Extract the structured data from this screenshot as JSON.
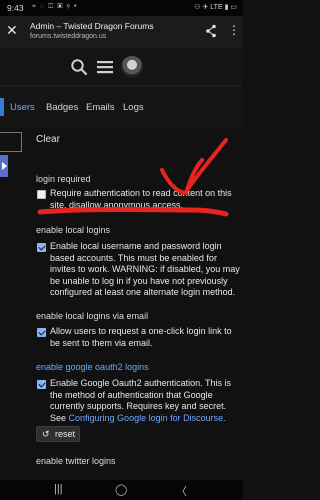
{
  "status_bar": {
    "time": "9:43",
    "left_icons": "⌖ ◌ ◫ ▣ ⚲ •",
    "right_icons": "⚇ ✈ LTE ▮ ▭"
  },
  "browser": {
    "close_symbol": "✕",
    "page_title": "Admin – Twisted Dragon Forums",
    "url": "forums.twisteddragon.us",
    "menu_symbol": "⋮"
  },
  "header": {
    "search_icon": "search-icon",
    "menu_icon": "hamburger-icon",
    "avatar_icon": "avatar"
  },
  "tabs": [
    {
      "label": "Users",
      "active": true
    },
    {
      "label": "Badges",
      "active": false
    },
    {
      "label": "Emails",
      "active": false
    },
    {
      "label": "Logs",
      "active": false
    }
  ],
  "filter": {
    "value": "",
    "clear_label": "Clear"
  },
  "settings": [
    {
      "title": "login required",
      "checked": false,
      "description": "Require authentication to read content on this site, disallow anonymous access."
    },
    {
      "title": "enable local logins",
      "checked": true,
      "description": "Enable local username and password login based accounts. This must be enabled for invites to work. WARNING: if disabled, you may be unable to log in if you have not previously configured at least one alternate login method."
    },
    {
      "title": "enable local logins via email",
      "checked": true,
      "description": "Allow users to request a one-click login link to be sent to them via email."
    },
    {
      "title": "enable google oauth2 logins",
      "checked": true,
      "description": "Enable Google Oauth2 authentication. This is the method of authentication that Google currently supports. Requires key and secret. See",
      "link_text": "Configuring Google login for Discourse."
    },
    {
      "title": "enable twitter logins"
    }
  ],
  "reset": {
    "icon": "↺",
    "label": "reset"
  },
  "nav_bar": {
    "recents": "|||",
    "home": "◯",
    "back": "〈"
  },
  "colors": {
    "accent": "#6fa8ff",
    "annotation_red": "#e8241e",
    "background": "#111111"
  }
}
